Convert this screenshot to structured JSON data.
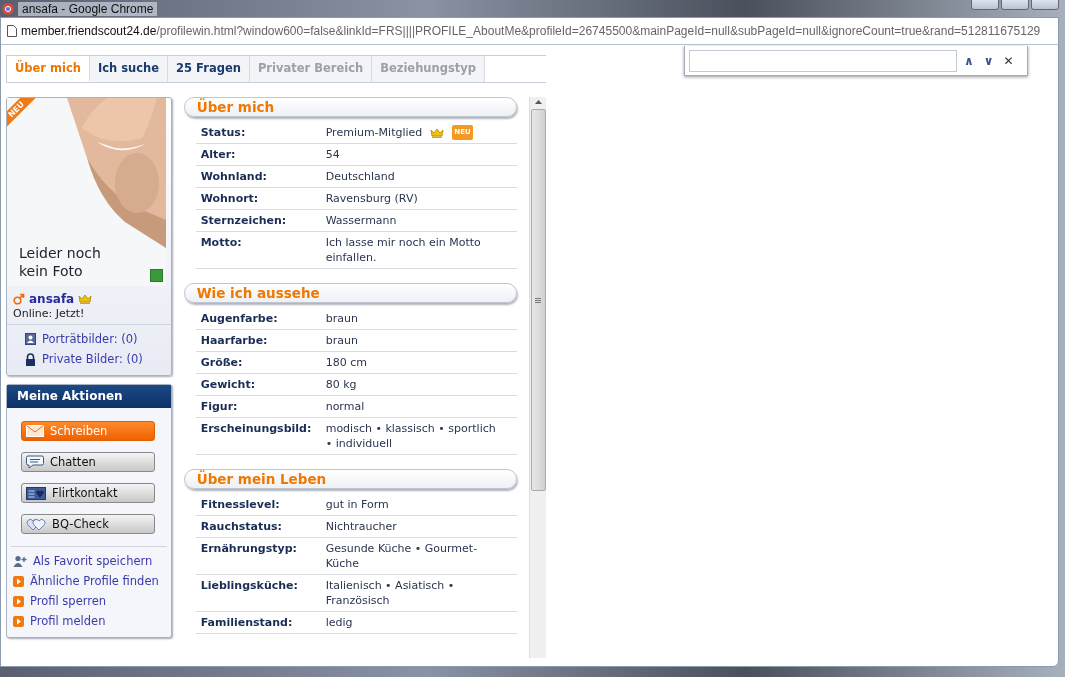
{
  "window": {
    "title": "ansafa - Google Chrome"
  },
  "address_bar": {
    "host": "member.friendscout24.de",
    "path": "/profilewin.html?window600=false&linkId=FRS||||PROFILE_AboutMe&profileId=26745500&mainPageId=null&subPageId=null&ignoreCount=true&rand=512811675129"
  },
  "find_bar": {
    "up": "∧",
    "down": "∨",
    "close": "✕"
  },
  "tabs": [
    {
      "label": "Über mich",
      "selected": true,
      "disabled": false
    },
    {
      "label": "Ich suche",
      "selected": false,
      "disabled": false
    },
    {
      "label": "25 Fragen",
      "selected": false,
      "disabled": false
    },
    {
      "label": "Privater Bereich",
      "selected": false,
      "disabled": true
    },
    {
      "label": "Beziehungstyp",
      "selected": false,
      "disabled": true
    }
  ],
  "profile_card": {
    "ribbon": "NEU",
    "photo_caption": "Leider noch kein Foto",
    "username": "ansafa",
    "premium": true,
    "online": "Online: Jetzt!",
    "links": [
      {
        "kind": "portrait",
        "label": "Porträtbilder: (0)"
      },
      {
        "kind": "private",
        "label": "Private Bilder: (0)"
      }
    ]
  },
  "actions": {
    "title": "Meine Aktionen",
    "buttons": [
      {
        "kind": "mail",
        "label": "Schreiben",
        "primary": true
      },
      {
        "kind": "chat",
        "label": "Chatten",
        "primary": false
      },
      {
        "kind": "flirt",
        "label": "Flirtkontakt",
        "primary": false
      },
      {
        "kind": "hearts",
        "label": "BQ-Check",
        "primary": false
      }
    ],
    "links": [
      {
        "kind": "favorite",
        "label": "Als Favorit speichern"
      },
      {
        "kind": "arrow",
        "label": "Ähnliche Profile finden"
      },
      {
        "kind": "arrow",
        "label": "Profil sperren"
      },
      {
        "kind": "arrow",
        "label": "Profil melden"
      }
    ]
  },
  "sections": [
    {
      "title": "Über mich",
      "rows": [
        {
          "label": "Status:",
          "value": "Premium-Mitglied",
          "premium": true,
          "badge": "NEU"
        },
        {
          "label": "Alter:",
          "value": "54"
        },
        {
          "label": "Wohnland:",
          "value": "Deutschland"
        },
        {
          "label": "Wohnort:",
          "value": "Ravensburg (RV)"
        },
        {
          "label": "Sternzeichen:",
          "value": "Wassermann"
        },
        {
          "label": "Motto:",
          "value": "Ich lasse mir noch ein Motto einfallen."
        }
      ]
    },
    {
      "title": "Wie ich aussehe",
      "rows": [
        {
          "label": "Augenfarbe:",
          "value": "braun"
        },
        {
          "label": "Haarfarbe:",
          "value": "braun"
        },
        {
          "label": "Größe:",
          "value": "180 cm"
        },
        {
          "label": "Gewicht:",
          "value": "80 kg"
        },
        {
          "label": "Figur:",
          "value": "normal"
        },
        {
          "label": "Erscheinungsbild:",
          "value": "modisch  •  klassisch  •  sportlich  •  individuell"
        }
      ]
    },
    {
      "title": "Über mein Leben",
      "rows": [
        {
          "label": "Fitnesslevel:",
          "value": "gut in Form"
        },
        {
          "label": "Rauchstatus:",
          "value": "Nichtraucher"
        },
        {
          "label": "Ernährungstyp:",
          "value": "Gesunde Küche  •  Gourmet-Küche"
        },
        {
          "label": "Lieblingsküche:",
          "value": "Italienisch  •  Asiatisch  •  Französisch"
        },
        {
          "label": "Familienstand:",
          "value": "ledig"
        }
      ]
    }
  ]
}
